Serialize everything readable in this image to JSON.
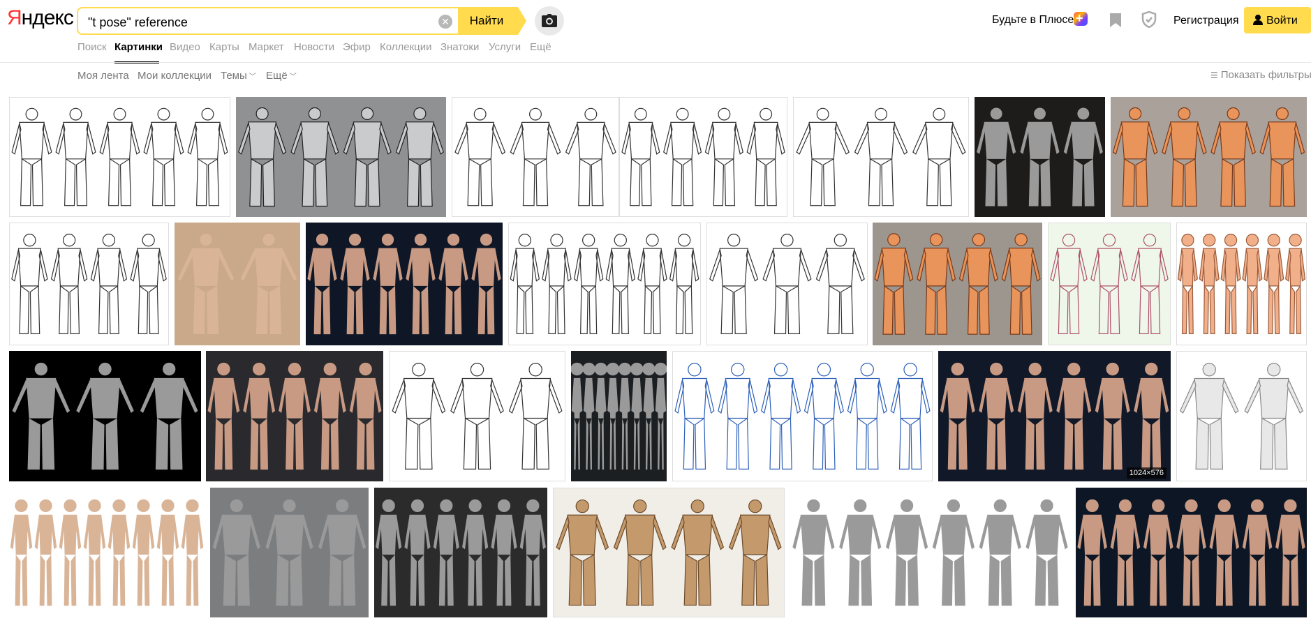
{
  "header": {
    "logo_first": "Я",
    "logo_rest": "ндекс",
    "search_value": "\"t pose\" reference",
    "search_button": "Найти",
    "plus_label": "Будьте в Плюсе",
    "register_label": "Регистрация",
    "login_label": "Войти"
  },
  "nav": {
    "tabs": [
      "Поиск",
      "Картинки",
      "Видео",
      "Карты",
      "Маркет",
      "Новости",
      "Эфир",
      "Коллекции",
      "Знатоки",
      "Услуги",
      "Ещё"
    ],
    "active_tab": "Картинки"
  },
  "subnav": {
    "feed": "Моя лента",
    "collections": "Мои коллекции",
    "themes": "Темы",
    "more": "Ещё",
    "show_filters": "Показать фильтры"
  },
  "results": {
    "badge": "1024×576",
    "tiles": [
      {
        "kind": "lineart",
        "bg": "#ffffff",
        "figures": 5
      },
      {
        "kind": "silhouette",
        "bg": "#8f9193",
        "figures": 4
      },
      {
        "kind": "lineart",
        "bg": "#ffffff",
        "figures": 3
      },
      {
        "kind": "lineart",
        "bg": "#ffffff",
        "figures": 4
      },
      {
        "kind": "lineart",
        "bg": "#ffffff",
        "figures": 3
      },
      {
        "kind": "render",
        "bg": "#1e1c1a",
        "figures": 3
      },
      {
        "kind": "muscle",
        "bg": "#a9a19a",
        "figures": 4
      },
      {
        "kind": "lineart",
        "bg": "#ffffff",
        "figures": 4
      },
      {
        "kind": "photo",
        "bg": "#c9a98a",
        "figures": 2
      },
      {
        "kind": "photo-dark",
        "bg": "#0f1726",
        "figures": 6
      },
      {
        "kind": "lineart",
        "bg": "#ffffff",
        "figures": 6
      },
      {
        "kind": "lineart",
        "bg": "#ffffff",
        "figures": 3
      },
      {
        "kind": "muscle",
        "bg": "#9d968f",
        "figures": 4
      },
      {
        "kind": "sketch",
        "bg": "#eef7ea",
        "figures": 3
      },
      {
        "kind": "sketch-orange",
        "bg": "#ffffff",
        "figures": 6
      },
      {
        "kind": "render",
        "bg": "#000000",
        "figures": 3
      },
      {
        "kind": "photo-dark",
        "bg": "#2a2a2e",
        "figures": 5
      },
      {
        "kind": "lineart",
        "bg": "#ffffff",
        "figures": 3
      },
      {
        "kind": "render",
        "bg": "#1c1f22",
        "figures": 8
      },
      {
        "kind": "blue-sketch",
        "bg": "#ffffff",
        "figures": 6
      },
      {
        "kind": "photo-dark",
        "bg": "#111827",
        "figures": 6
      },
      {
        "kind": "mesh",
        "bg": "#ffffff",
        "figures": 2
      },
      {
        "kind": "photo",
        "bg": "#ffffff",
        "figures": 8
      },
      {
        "kind": "render",
        "bg": "#7b7d7f",
        "figures": 3
      },
      {
        "kind": "render",
        "bg": "#2b2b2b",
        "figures": 6
      },
      {
        "kind": "tan",
        "bg": "#f1eee8",
        "figures": 4
      },
      {
        "kind": "render",
        "bg": "#ffffff",
        "figures": 6
      },
      {
        "kind": "photo-dark",
        "bg": "#0c1624",
        "figures": 7
      }
    ]
  },
  "colors": {
    "accent_yellow": "#ffdb4d",
    "logo_red": "#ff3333",
    "muted_text": "#999999"
  }
}
